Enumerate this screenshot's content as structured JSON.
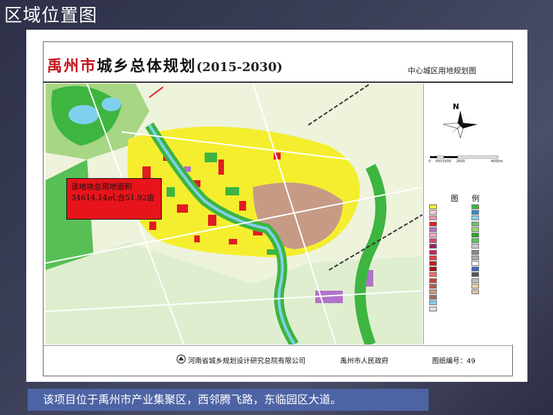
{
  "slide": {
    "title": "区域位置图"
  },
  "map": {
    "title_red": "禹州市",
    "title_black": "城乡总体规划",
    "title_years": "(2015-2030)",
    "subtitle": "中心城区用地规划图",
    "north": "N",
    "scale": [
      "0",
      "500",
      "1000",
      "2000",
      "4000m"
    ],
    "callout_lines": [
      "该地块总用地面积",
      "34614.14㎡,合51.92亩"
    ],
    "legend_title": "图 例",
    "colors": {
      "residential": "#f4ee2f",
      "commercial": "#e21c24",
      "industrial": "#c79a86",
      "green": "#3db540",
      "water": "#7fd0ee",
      "road": "#ffffff",
      "purple": "#b173c9"
    }
  },
  "footer": {
    "institute": "河南省城乡规划设计研究总院有限公司",
    "government": "禹州市人民政府",
    "drawing_no": "图纸编号：49"
  },
  "caption": "该项目位于禹州市产业集聚区，西邻腾飞路，东临园区大道。"
}
